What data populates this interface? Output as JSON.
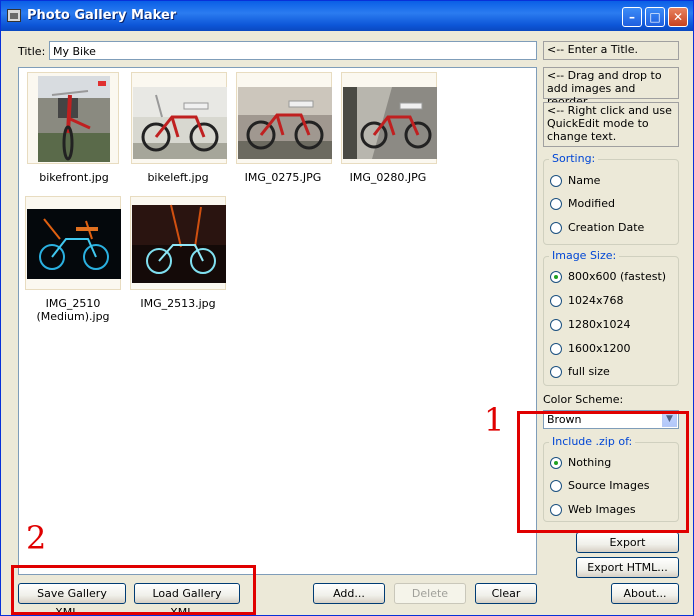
{
  "window": {
    "title": "Photo Gallery Maker"
  },
  "title_field": {
    "label": "Title:",
    "value": "My Bike"
  },
  "hints": [
    "<-- Enter a Title.",
    "<-- Drag and drop to add images and reorder.",
    "<-- Right click and use QuickEdit mode to change text."
  ],
  "gallery": {
    "images": [
      {
        "caption": "bikefront.jpg"
      },
      {
        "caption": "bikeleft.jpg"
      },
      {
        "caption": "IMG_0275.JPG"
      },
      {
        "caption": "IMG_0280.JPG"
      },
      {
        "caption": "IMG_2510 (Medium).jpg"
      },
      {
        "caption": "IMG_2513.jpg"
      }
    ]
  },
  "sorting": {
    "title": "Sorting:",
    "options": [
      "Name",
      "Modified",
      "Creation Date"
    ]
  },
  "image_size": {
    "title": "Image Size:",
    "options": [
      "800x600 (fastest)",
      "1024x768",
      "1280x1024",
      "1600x1200",
      "full size"
    ],
    "selected": "800x600 (fastest)"
  },
  "color_scheme": {
    "label": "Color Scheme:",
    "value": "Brown"
  },
  "include_zip": {
    "title": "Include .zip of:",
    "options": [
      "Nothing",
      "Source Images",
      "Web Images"
    ],
    "selected": "Nothing"
  },
  "buttons": {
    "export_webpage": "Export Webpage...",
    "export_html": "Export HTML...",
    "save_xml": "Save Gallery XML...",
    "load_xml": "Load Gallery XML...",
    "add": "Add...",
    "delete": "Delete",
    "clear": "Clear",
    "about": "About..."
  },
  "annotations": [
    "1",
    "2"
  ],
  "colors": {
    "title_bar": "#0a5fe6",
    "annotation": "#e00000",
    "group_title": "#0046d5"
  }
}
